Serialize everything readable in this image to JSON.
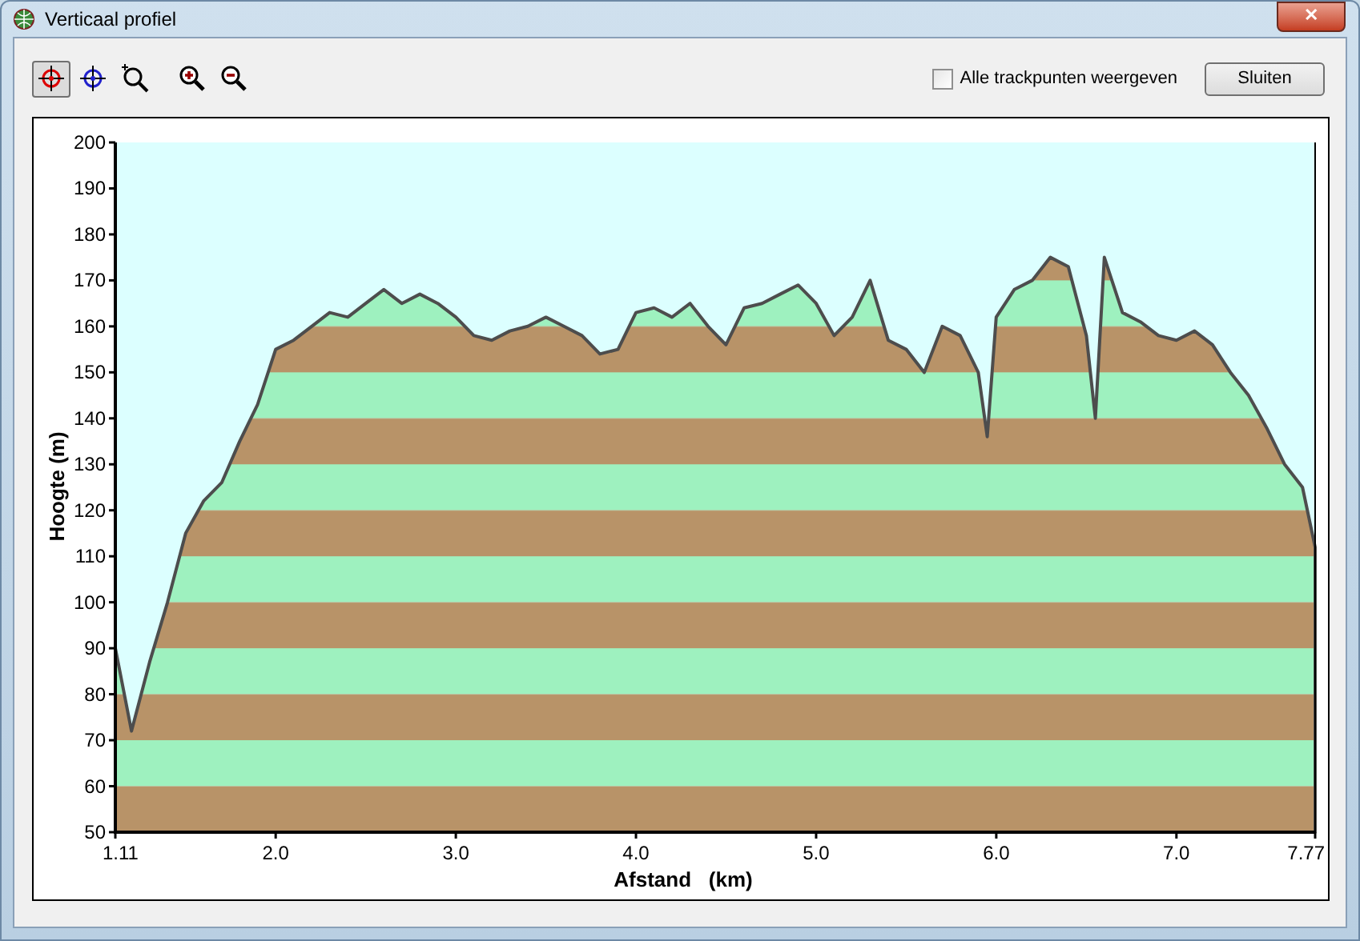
{
  "window": {
    "title": "Verticaal profiel",
    "close_label": "✕"
  },
  "toolbar": {
    "tools": [
      {
        "kind": "crosshair-red",
        "selected": true
      },
      {
        "kind": "crosshair-blue",
        "selected": false
      },
      {
        "kind": "zoom-area",
        "selected": false
      },
      {
        "kind": "zoom-in",
        "selected": false
      },
      {
        "kind": "zoom-out",
        "selected": false
      }
    ],
    "show_all_points": {
      "label": "Alle trackpunten weergeven",
      "checked": false
    },
    "close_button": "Sluiten"
  },
  "chart": {
    "chart_data": {
      "type": "area",
      "xlabel": "Afstand   (km)",
      "ylabel": "Hoogte (m)",
      "xlim": [
        1.11,
        7.77
      ],
      "ylim": [
        50,
        200
      ],
      "xticks": [
        {
          "value": 1.11,
          "label": "1.11"
        },
        {
          "value": 2,
          "label": "2.0"
        },
        {
          "value": 3,
          "label": "3.0"
        },
        {
          "value": 4,
          "label": "4.0"
        },
        {
          "value": 5,
          "label": "5.0"
        },
        {
          "value": 6,
          "label": "6.0"
        },
        {
          "value": 7,
          "label": "7.0"
        },
        {
          "value": 7.77,
          "label": "7.77"
        }
      ],
      "yticks": [
        50,
        60,
        70,
        80,
        90,
        100,
        110,
        120,
        130,
        140,
        150,
        160,
        170,
        180,
        190,
        200
      ],
      "x": [
        1.11,
        1.2,
        1.3,
        1.4,
        1.5,
        1.6,
        1.7,
        1.8,
        1.9,
        2.0,
        2.1,
        2.2,
        2.3,
        2.4,
        2.5,
        2.6,
        2.7,
        2.8,
        2.9,
        3.0,
        3.1,
        3.2,
        3.3,
        3.4,
        3.5,
        3.6,
        3.7,
        3.8,
        3.9,
        4.0,
        4.1,
        4.2,
        4.3,
        4.4,
        4.5,
        4.6,
        4.7,
        4.8,
        4.9,
        5.0,
        5.1,
        5.2,
        5.3,
        5.4,
        5.5,
        5.6,
        5.7,
        5.8,
        5.9,
        5.95,
        6.0,
        6.1,
        6.2,
        6.3,
        6.4,
        6.5,
        6.55,
        6.6,
        6.7,
        6.8,
        6.9,
        7.0,
        7.1,
        7.2,
        7.3,
        7.4,
        7.5,
        7.6,
        7.7,
        7.77
      ],
      "series": [
        {
          "color": "#4d4d4d",
          "values": [
            90,
            72,
            87,
            100,
            115,
            122,
            126,
            135,
            143,
            155,
            157,
            160,
            163,
            162,
            165,
            168,
            165,
            167,
            165,
            162,
            158,
            157,
            159,
            160,
            162,
            160,
            158,
            154,
            155,
            163,
            164,
            162,
            165,
            160,
            156,
            164,
            165,
            167,
            169,
            165,
            158,
            162,
            170,
            157,
            155,
            150,
            160,
            158,
            150,
            136,
            162,
            168,
            170,
            175,
            173,
            158,
            140,
            175,
            163,
            161,
            158,
            157,
            159,
            156,
            150,
            145,
            138,
            130,
            125,
            112
          ]
        }
      ]
    }
  }
}
